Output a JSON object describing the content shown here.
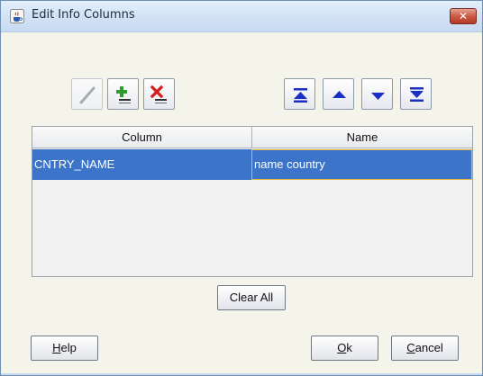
{
  "window": {
    "title": "Edit Info Columns",
    "close_glyph": "✕",
    "title_icon": "java-cup-icon"
  },
  "toolbar": {
    "left_buttons": [
      {
        "icon": "edit-pencil-icon",
        "enabled": false
      },
      {
        "icon": "add-row-icon",
        "enabled": true
      },
      {
        "icon": "delete-row-icon",
        "enabled": true
      }
    ],
    "right_buttons": [
      {
        "icon": "move-to-top-icon"
      },
      {
        "icon": "move-up-icon"
      },
      {
        "icon": "move-down-icon"
      },
      {
        "icon": "move-to-bottom-icon"
      }
    ]
  },
  "table": {
    "columns": [
      "Column",
      "Name"
    ],
    "rows": [
      {
        "column": "CNTRY_NAME",
        "name": "name country",
        "selected": true
      }
    ]
  },
  "buttons": {
    "clear_all": "Clear All",
    "help_mnemonic": "H",
    "help_rest": "elp",
    "ok_mnemonic": "O",
    "ok_rest": "k",
    "cancel_mnemonic": "C",
    "cancel_rest": "ancel"
  },
  "colors": {
    "selection": "#3b74c9",
    "arrow": "#1a2fc4",
    "add_plus": "#2e9b2e",
    "delete_x": "#d61c1c"
  }
}
